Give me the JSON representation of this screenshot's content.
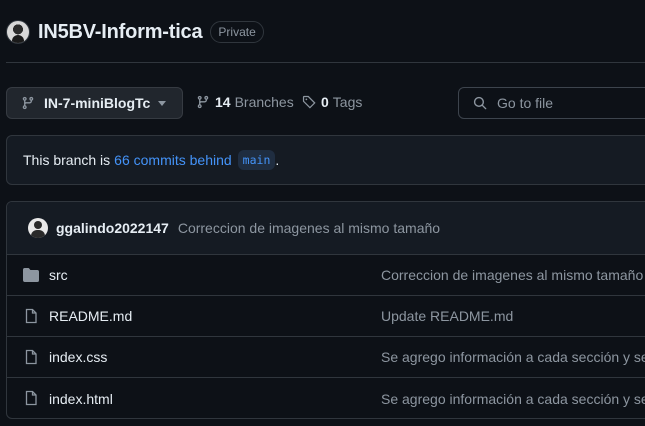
{
  "repo": {
    "name": "IN5BV-Inform-tica",
    "visibility": "Private"
  },
  "toolbar": {
    "branch": "IN-7-miniBlogTc",
    "branches_count": "14",
    "branches_label": "Branches",
    "tags_count": "0",
    "tags_label": "Tags",
    "search_placeholder": "Go to file"
  },
  "branch_info": {
    "prefix": "This branch is",
    "link": "66 commits behind",
    "base": "main",
    "suffix": "."
  },
  "latest_commit": {
    "author": "ggalindo2022147",
    "message": "Correccion de imagenes al mismo tamaño"
  },
  "files": [
    {
      "type": "folder",
      "icon": "folder-icon",
      "name": "src",
      "message": "Correccion de imagenes al mismo tamaño"
    },
    {
      "type": "file",
      "icon": "file-icon",
      "name": "README.md",
      "message": "Update README.md"
    },
    {
      "type": "file",
      "icon": "file-icon",
      "name": "index.css",
      "message": "Se agrego información a cada sección y se"
    },
    {
      "type": "file",
      "icon": "file-icon",
      "name": "index.html",
      "message": "Se agrego información a cada sección y se"
    }
  ],
  "colors": {
    "background": "#0d1117",
    "border": "#30363d",
    "link": "#4493f8",
    "muted": "#8d96a0"
  }
}
